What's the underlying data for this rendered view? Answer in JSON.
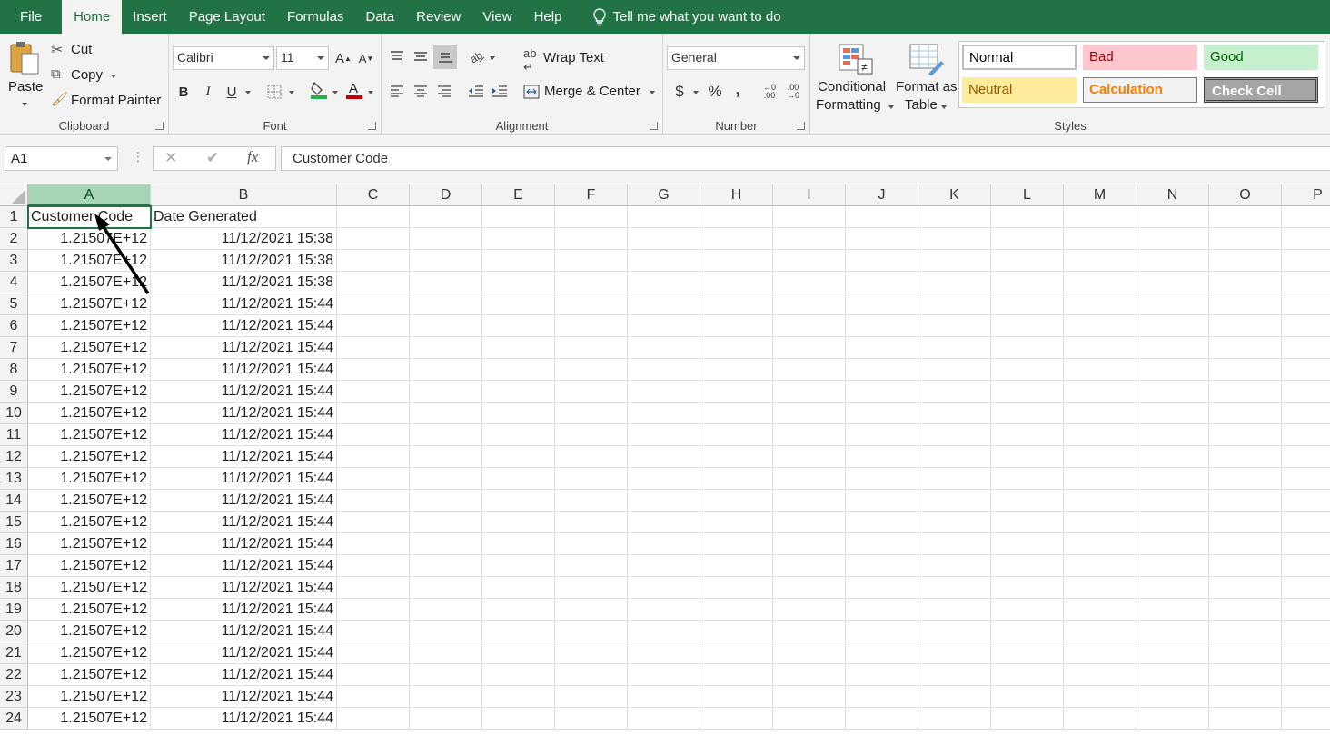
{
  "menu": {
    "tabs": [
      "File",
      "Home",
      "Insert",
      "Page Layout",
      "Formulas",
      "Data",
      "Review",
      "View",
      "Help"
    ],
    "tell_me": "Tell me what you want to do"
  },
  "ribbon": {
    "clipboard": {
      "paste": "Paste",
      "cut": "Cut",
      "copy": "Copy",
      "format_painter": "Format Painter",
      "label": "Clipboard"
    },
    "font": {
      "name": "Calibri",
      "size": "11",
      "bold": "B",
      "italic": "I",
      "underline": "U",
      "label": "Font"
    },
    "alignment": {
      "wrap_text": "Wrap Text",
      "merge_center": "Merge & Center",
      "label": "Alignment"
    },
    "number": {
      "format": "General",
      "currency": "$",
      "percent": "%",
      "comma": ",",
      "label": "Number"
    },
    "styles": {
      "conditional_formatting": "Conditional Formatting",
      "cf_line1": "Conditional",
      "cf_line2": "Formatting",
      "fat_line1": "Format as",
      "fat_line2": "Table",
      "normal": "Normal",
      "bad": "Bad",
      "good": "Good",
      "neutral": "Neutral",
      "calculation": "Calculation",
      "check_cell": "Check Cell",
      "label": "Styles"
    }
  },
  "formula_bar": {
    "name_box": "A1",
    "fx": "fx",
    "content": "Customer Code"
  },
  "sheet": {
    "columns": [
      "A",
      "B",
      "C",
      "D",
      "E",
      "F",
      "G",
      "H",
      "I",
      "J",
      "K",
      "L",
      "M",
      "N",
      "O",
      "P"
    ],
    "rows": [
      {
        "n": "1",
        "a": "Customer Code",
        "b": "Date Generated"
      },
      {
        "n": "2",
        "a": "1.21507E+12",
        "b": "11/12/2021 15:38"
      },
      {
        "n": "3",
        "a": "1.21507E+12",
        "b": "11/12/2021 15:38"
      },
      {
        "n": "4",
        "a": "1.21507E+12",
        "b": "11/12/2021 15:38"
      },
      {
        "n": "5",
        "a": "1.21507E+12",
        "b": "11/12/2021 15:44"
      },
      {
        "n": "6",
        "a": "1.21507E+12",
        "b": "11/12/2021 15:44"
      },
      {
        "n": "7",
        "a": "1.21507E+12",
        "b": "11/12/2021 15:44"
      },
      {
        "n": "8",
        "a": "1.21507E+12",
        "b": "11/12/2021 15:44"
      },
      {
        "n": "9",
        "a": "1.21507E+12",
        "b": "11/12/2021 15:44"
      },
      {
        "n": "10",
        "a": "1.21507E+12",
        "b": "11/12/2021 15:44"
      },
      {
        "n": "11",
        "a": "1.21507E+12",
        "b": "11/12/2021 15:44"
      },
      {
        "n": "12",
        "a": "1.21507E+12",
        "b": "11/12/2021 15:44"
      },
      {
        "n": "13",
        "a": "1.21507E+12",
        "b": "11/12/2021 15:44"
      },
      {
        "n": "14",
        "a": "1.21507E+12",
        "b": "11/12/2021 15:44"
      },
      {
        "n": "15",
        "a": "1.21507E+12",
        "b": "11/12/2021 15:44"
      },
      {
        "n": "16",
        "a": "1.21507E+12",
        "b": "11/12/2021 15:44"
      },
      {
        "n": "17",
        "a": "1.21507E+12",
        "b": "11/12/2021 15:44"
      },
      {
        "n": "18",
        "a": "1.21507E+12",
        "b": "11/12/2021 15:44"
      },
      {
        "n": "19",
        "a": "1.21507E+12",
        "b": "11/12/2021 15:44"
      },
      {
        "n": "20",
        "a": "1.21507E+12",
        "b": "11/12/2021 15:44"
      },
      {
        "n": "21",
        "a": "1.21507E+12",
        "b": "11/12/2021 15:44"
      },
      {
        "n": "22",
        "a": "1.21507E+12",
        "b": "11/12/2021 15:44"
      },
      {
        "n": "23",
        "a": "1.21507E+12",
        "b": "11/12/2021 15:44"
      },
      {
        "n": "24",
        "a": "1.21507E+12",
        "b": "11/12/2021 15:44"
      }
    ]
  },
  "colors": {
    "excel_green": "#217346",
    "selected_header": "#a6d5b5"
  }
}
